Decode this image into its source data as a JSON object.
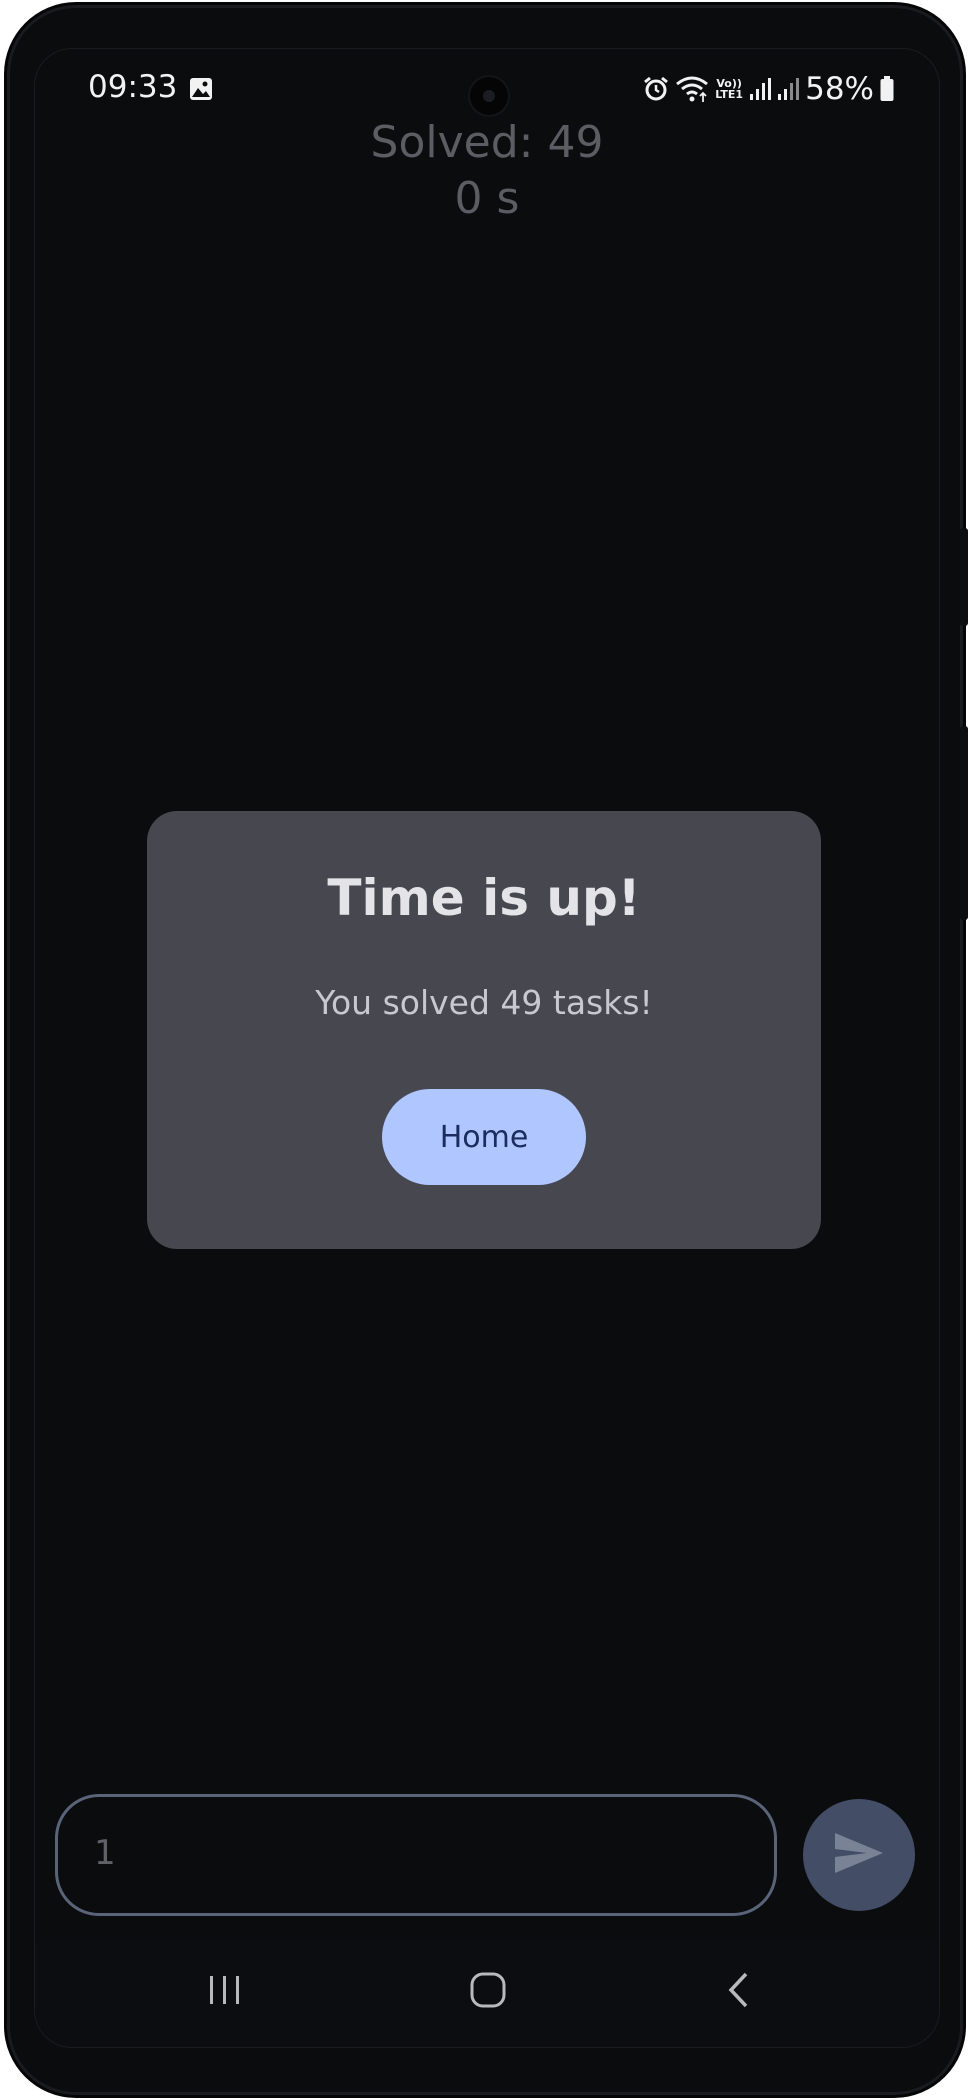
{
  "status_bar": {
    "time": "09:33",
    "gallery_icon": "gallery-icon",
    "alarm_icon": "alarm-icon",
    "wifi_icon": "wifi-icon",
    "lte_label_top": "Vo))",
    "lte_label_bottom": "LTE1",
    "signal_icons": [
      "signal-1-icon",
      "signal-2-icon"
    ],
    "battery_percent": "58%",
    "battery_icon": "battery-icon"
  },
  "game": {
    "solved_label": "Solved: 49",
    "timer_label": "0 s"
  },
  "dialog": {
    "title": "Time is up!",
    "message": "You solved 49 tasks!",
    "home_button": "Home"
  },
  "answer_input": {
    "value": "1"
  },
  "send_button": {
    "icon": "send-icon"
  },
  "nav_bar": {
    "recents_icon": "recents-icon",
    "home_icon": "home-icon",
    "back_icon": "back-icon"
  },
  "colors": {
    "background": "#0a0c0e",
    "dialog": "#46474f",
    "home_button": "#b0c6ff",
    "send_button": "#434d66",
    "input_border": "#5a6478"
  }
}
